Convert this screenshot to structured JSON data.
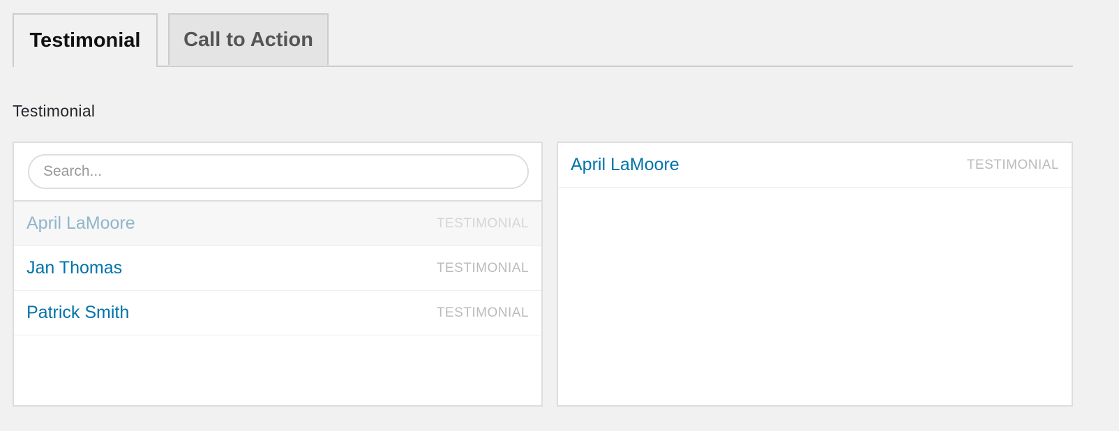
{
  "tabs": [
    {
      "label": "Testimonial",
      "active": true
    },
    {
      "label": "Call to Action",
      "active": false
    }
  ],
  "section": {
    "title": "Testimonial"
  },
  "search": {
    "placeholder": "Search...",
    "value": ""
  },
  "available": {
    "items": [
      {
        "name": "April LaMoore",
        "type": "TESTIMONIAL",
        "state": "selected"
      },
      {
        "name": "Jan Thomas",
        "type": "TESTIMONIAL",
        "state": "available"
      },
      {
        "name": "Patrick Smith",
        "type": "TESTIMONIAL",
        "state": "available"
      }
    ]
  },
  "selected": {
    "items": [
      {
        "name": "April LaMoore",
        "type": "TESTIMONIAL"
      }
    ]
  },
  "colors": {
    "link": "#0073aa",
    "link_disabled": "#8eb6cb",
    "background": "#f1f1f1",
    "border": "#dddddd"
  }
}
